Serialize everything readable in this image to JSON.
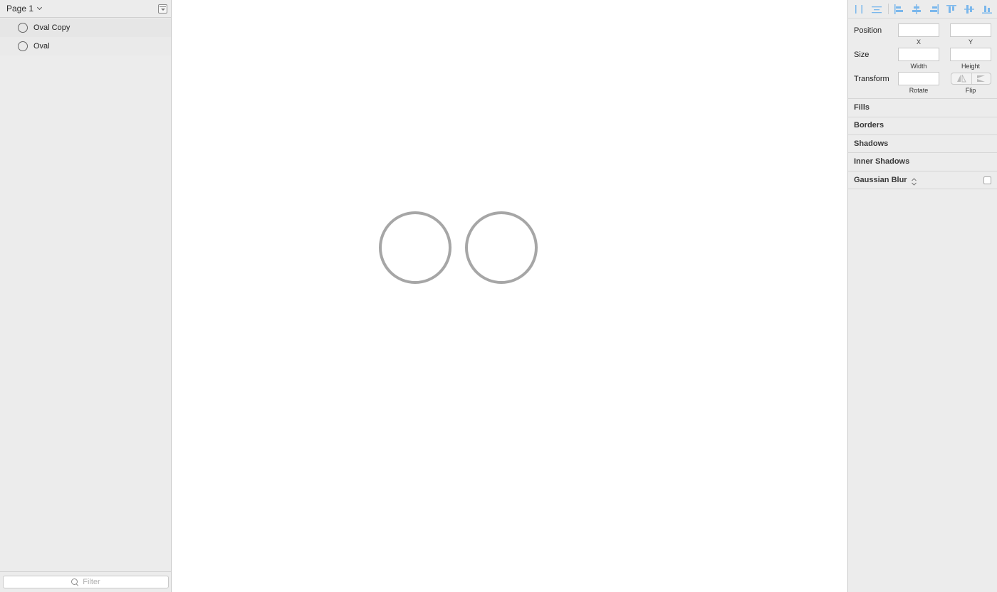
{
  "layers_panel": {
    "page_selector": "Page 1",
    "layers": [
      {
        "label": "Oval Copy"
      },
      {
        "label": "Oval"
      }
    ],
    "filter_placeholder": "Filter"
  },
  "inspector": {
    "position": {
      "label": "Position",
      "x_label": "X",
      "y_label": "Y"
    },
    "size": {
      "label": "Size",
      "width_label": "Width",
      "height_label": "Height"
    },
    "transform": {
      "label": "Transform",
      "rotate_label": "Rotate",
      "flip_label": "Flip"
    },
    "sections": {
      "fills": "Fills",
      "borders": "Borders",
      "shadows": "Shadows",
      "inner_shadows": "Inner Shadows",
      "gaussian_blur": "Gaussian Blur"
    }
  },
  "colors": {
    "panel_bg": "#ececec",
    "align_icon": "#7ab7ec",
    "oval_stroke": "#a6a6a6"
  },
  "icons": [
    "chevron-down-icon",
    "collapse-icon",
    "oval-icon",
    "search-icon",
    "align-icons",
    "flip-horizontal-icon",
    "flip-vertical-icon",
    "updown-icon"
  ]
}
